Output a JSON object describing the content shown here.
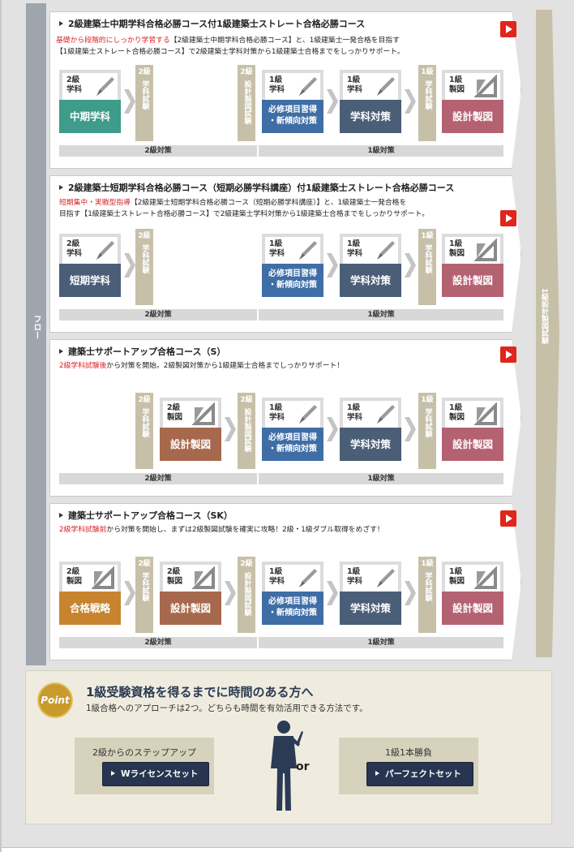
{
  "flow_label": "フロー",
  "arrow_column_label": "1級設計製図試験",
  "courses": [
    {
      "title": "2級建築士中期学科合格必勝コース付1級建築士ストレート合格必勝コース",
      "desc_red": "基礎から段階的にしっかり学習する",
      "desc_line1": "【2級建築士中期学科合格必勝コース】と、1級建築士一発合格を目指す",
      "desc_line2": "【1級建築士ストレート合格必勝コース】で2級建築士学科対策から1級建築士合格までをしっかりサポート。",
      "grade2": "2級対策",
      "grade1": "1級対策"
    },
    {
      "title": "2級建築士短期学科合格必勝コース（短期必勝学科講座）付1級建築士ストレート合格必勝コース",
      "desc_red": "短期集中・実戦型指導",
      "desc_line1": "【2級建築士短期学科合格必勝コース（短期必勝学科講座）】と、1級建築士一発合格を",
      "desc_line2": "目指す【1級建築士ストレート合格必勝コース】で2級建築士学科対策から1級建築士合格までをしっかりサポート。",
      "grade2": "2級対策",
      "grade1": "1級対策"
    },
    {
      "title": "建築士サポートアップ合格コース（S）",
      "desc_red": "2級学科試験後",
      "desc_line1": "から対策を開始。2級製図対策から1級建築士合格までしっかりサポート！",
      "grade2": "2級対策",
      "grade1": "1級対策"
    },
    {
      "title": "建築士サポートアップ合格コース（SK）",
      "desc_red": "2級学科試験前",
      "desc_line1": "から対策を開始し、まずは2級製図試験を確実に攻略！2級・1級ダブル取得をめざす！",
      "grade2": "2級対策",
      "grade1": "1級対策"
    }
  ],
  "cards": {
    "lv2": "2級",
    "lv1": "1級",
    "gakka": "学科",
    "seizu": "製図",
    "chuki": "中期学科",
    "tanki": "短期学科",
    "hisshu_1": "必修項目習得",
    "hisshu_2": "・新傾向対策",
    "gakka_taisaku": "学科対策",
    "sekkei": "設計製図",
    "senryaku": "合格戦略"
  },
  "exams": {
    "lv2": "2級",
    "lv1": "1級",
    "gakka_shiken": "学科試験",
    "seizu_shiken": "設計製図試験"
  },
  "point": {
    "badge": "Point",
    "title": "1級受験資格を得るまでに時間のある方へ",
    "sub": "1級合格へのアプローチは2つ。どちらも時間を有効活用できる方法です。",
    "left_label": "2級からのステップアップ",
    "left_button": "Wライセンスセット",
    "or": "or",
    "right_label": "1級1本勝負",
    "right_button": "パーフェクトセット"
  }
}
